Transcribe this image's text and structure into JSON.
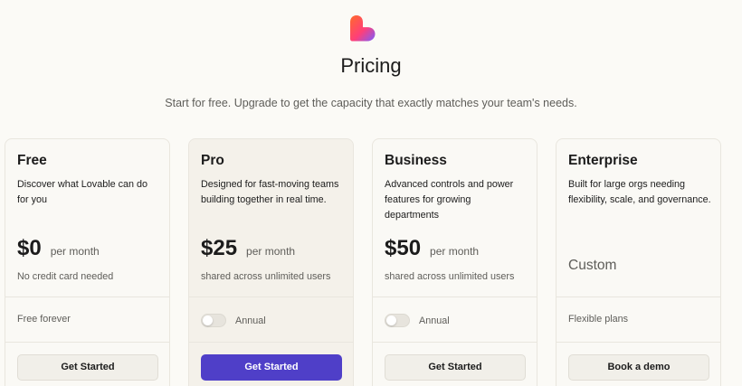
{
  "header": {
    "logo_icon": "heart-logo-icon",
    "title": "Pricing",
    "subtitle": "Start for free. Upgrade to get the capacity that exactly matches your team's needs."
  },
  "colors": {
    "primary_button": "#4f3fc8",
    "page_background": "#fbfaf6",
    "highlight_card": "#f4f1ea"
  },
  "plans": [
    {
      "name": "Free",
      "description": "Discover what Lovable can do for you",
      "price": "$0",
      "period": "per month",
      "note": "No credit card needed",
      "footer_text": "Free forever",
      "button": "Get Started"
    },
    {
      "name": "Pro",
      "description": "Designed for fast-moving teams building together in real time.",
      "price": "$25",
      "period": "per month",
      "note": "shared across unlimited users",
      "toggle_label": "Annual",
      "toggle_on": false,
      "button": "Get Started"
    },
    {
      "name": "Business",
      "description": "Advanced controls and power features for growing departments",
      "price": "$50",
      "period": "per month",
      "note": "shared across unlimited users",
      "toggle_label": "Annual",
      "toggle_on": false,
      "button": "Get Started"
    },
    {
      "name": "Enterprise",
      "description": "Built for large orgs needing flexibility, scale, and governance.",
      "custom_price": "Custom",
      "footer_text": "Flexible plans",
      "button": "Book a demo"
    }
  ]
}
